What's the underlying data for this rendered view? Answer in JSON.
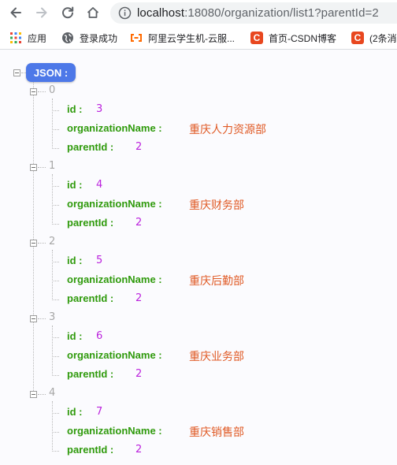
{
  "browser": {
    "url_host": "localhost",
    "url_rest": ":18080/organization/list1?parentId=2"
  },
  "bookmarks": [
    {
      "label": "应用",
      "icon": "apps-grid-icon"
    },
    {
      "label": "登录成功",
      "icon": "globe-icon"
    },
    {
      "label": "阿里云学生机-云服...",
      "icon": "aliyun-icon"
    },
    {
      "label": "首页-CSDN博客",
      "icon": "csdn-icon"
    },
    {
      "label": "(2条消",
      "icon": "csdn-icon"
    }
  ],
  "json": {
    "root_label": "JSON :",
    "key_labels": {
      "id": "id :",
      "organizationName": "organizationName :",
      "parentId": "parentId :"
    },
    "items": [
      {
        "index": "0",
        "id": "3",
        "organizationName": "重庆人力资源部",
        "parentId": "2"
      },
      {
        "index": "1",
        "id": "4",
        "organizationName": "重庆财务部",
        "parentId": "2"
      },
      {
        "index": "2",
        "id": "5",
        "organizationName": "重庆后勤部",
        "parentId": "2"
      },
      {
        "index": "3",
        "id": "6",
        "organizationName": "重庆业务部",
        "parentId": "2"
      },
      {
        "index": "4",
        "id": "7",
        "organizationName": "重庆销售部",
        "parentId": "2"
      }
    ]
  }
}
